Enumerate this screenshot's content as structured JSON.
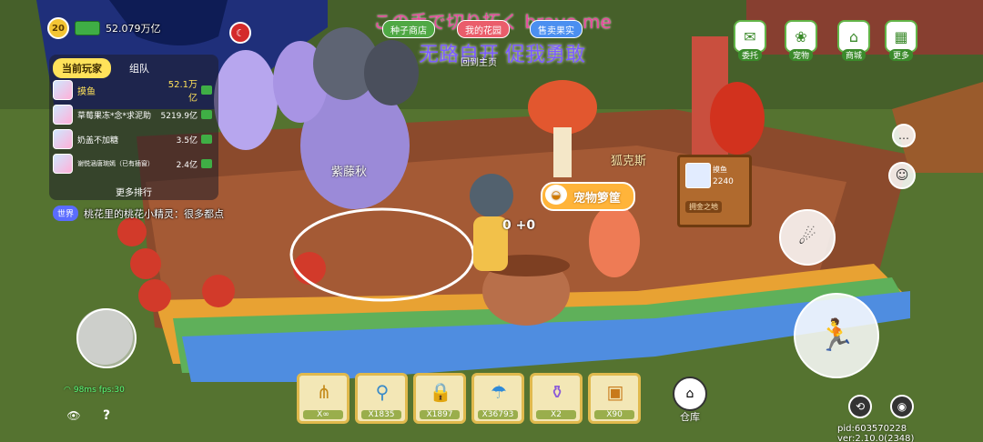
{
  "lyrics": {
    "line1": "この手で切り拓く brave me",
    "line2": "无路自开 促我勇敢"
  },
  "hud": {
    "level": "20",
    "coins": "52.079万亿"
  },
  "top_buttons": {
    "shop": "种子商店",
    "my_garden": "我的花园",
    "buy_sell": "售卖果实",
    "back_home": "回到主页"
  },
  "leaderboard": {
    "tab_current": "当前玩家",
    "tab_team": "组队",
    "players": [
      {
        "name": "摸鱼",
        "value": "52.1万亿"
      },
      {
        "name": "草莓果冻*念*求泥助",
        "value": "5219.9亿"
      },
      {
        "name": "奶盖不加糖",
        "value": "3.5亿"
      },
      {
        "name": "谢悦涵唐琬嫣（已有插窗）",
        "value": "2.4亿"
      }
    ],
    "more": "更多排行"
  },
  "chat": {
    "channel": "世界",
    "message": "桃花里的桃花小精灵：很多都点"
  },
  "right_menu": [
    {
      "icon": "commission-icon",
      "label": "委托"
    },
    {
      "icon": "pet-icon",
      "label": "宠物"
    },
    {
      "icon": "shop-icon",
      "label": "商城"
    },
    {
      "icon": "more-icon",
      "label": "更多"
    }
  ],
  "world_labels": {
    "plant": "紫藤秋",
    "npc_name": "狐克斯",
    "pet_basket": "宠物箩筐",
    "sign_owner": "摸鱼",
    "sign_likes": "2240",
    "sign_footer": "拥金之地",
    "drop_counter": "0 +0"
  },
  "hotbar": [
    {
      "icon": "pitchfork-icon",
      "count": "X∞"
    },
    {
      "icon": "magnifier-icon",
      "count": "X1835"
    },
    {
      "icon": "lock-icon",
      "count": "X1897"
    },
    {
      "icon": "watering-can-icon",
      "count": "X36793"
    },
    {
      "icon": "potion-icon",
      "count": "X2"
    },
    {
      "icon": "treasure-chest-icon",
      "count": "X90"
    }
  ],
  "warehouse": {
    "label": "仓库"
  },
  "status": {
    "ping": "98ms",
    "fps": "fps:30",
    "build": "pid:603570228 ver:2.10.0(2348)"
  },
  "colors": {
    "accent_yellow": "#ffe25a",
    "slot_border": "#e0b94d",
    "lyric_pink": "#e84a9c",
    "lyric_purple": "#7b5cff"
  }
}
